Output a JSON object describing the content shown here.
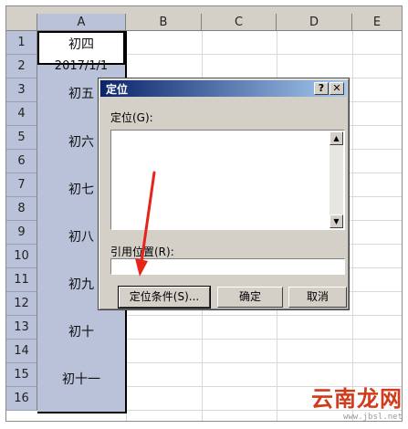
{
  "spreadsheet": {
    "columns": [
      "A",
      "B",
      "C",
      "D",
      "E"
    ],
    "rows": [
      "1",
      "2",
      "3",
      "4",
      "5",
      "6",
      "7",
      "8",
      "9",
      "10",
      "11",
      "12",
      "13",
      "14",
      "15",
      "16"
    ],
    "cells_A": [
      {
        "row": "1",
        "value": "初四"
      },
      {
        "row": "2",
        "value": "2017/1/1"
      },
      {
        "row": "3",
        "value": "初五"
      },
      {
        "row": "5",
        "value": "初六"
      },
      {
        "row": "7",
        "value": "初七"
      },
      {
        "row": "9",
        "value": "初八"
      },
      {
        "row": "11",
        "value": "初九"
      },
      {
        "row": "13",
        "value": "初十"
      },
      {
        "row": "15",
        "value": "初十一"
      }
    ],
    "selection_color": "#b9c2d9"
  },
  "dialog": {
    "title": "定位",
    "help_button": "?",
    "close_button": "✕",
    "goto_label": "定位(G):",
    "reference_label": "引用位置(R):",
    "reference_value": "",
    "special_button": "定位条件(S)...",
    "ok_button": "确定",
    "cancel_button": "取消",
    "title_color": "#0a246a"
  },
  "annotation": {
    "arrow_color": "#e8241a"
  },
  "watermark": {
    "text": "云南龙网",
    "url": "www.jbsl.net"
  }
}
